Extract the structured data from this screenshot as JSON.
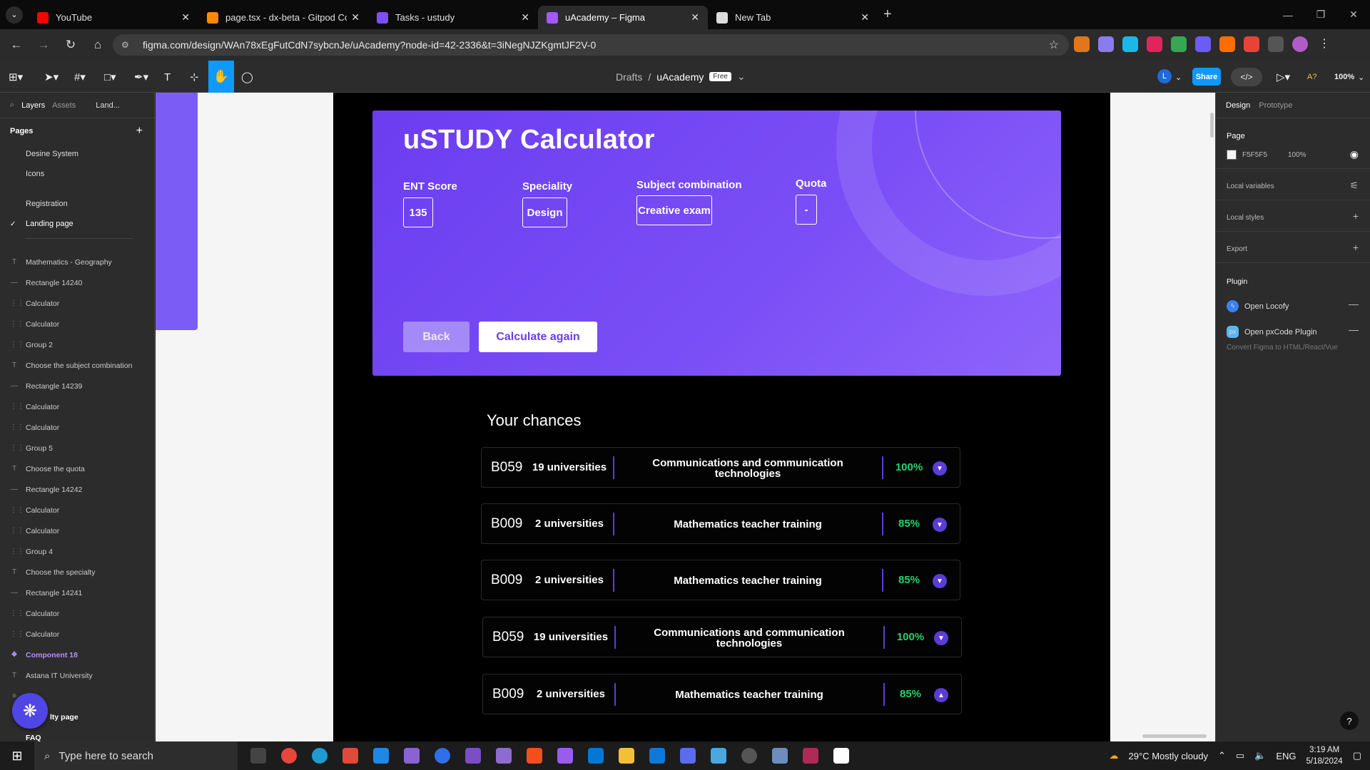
{
  "browser": {
    "tabs": [
      {
        "title": "YouTube",
        "color": "#ff0000",
        "active": false
      },
      {
        "title": "page.tsx - dx-beta - Gitpod Co",
        "color": "#ff8a00",
        "active": false
      },
      {
        "title": "Tasks - ustudy",
        "color": "#7b4ff6",
        "active": false
      },
      {
        "title": "uAcademy – Figma",
        "color": "#a259ff",
        "active": true
      },
      {
        "title": "New Tab",
        "color": "#dddddd",
        "active": false
      }
    ],
    "url": "figma.com/design/WAn78xEgFutCdN7sybcnJe/uAcademy?node-id=42-2336&t=3iNegNJZKgmtJF2V-0"
  },
  "figma": {
    "breadcrumb_root": "Drafts",
    "file_name": "uAcademy",
    "plan_badge": "Free",
    "user_initial": "L",
    "share_label": "Share",
    "zoom": "100%",
    "left_tabs": {
      "layers": "Layers",
      "assets": "Assets",
      "page_short": "Land..."
    },
    "pages_heading": "Pages",
    "pages": [
      "Desine System",
      "Icons",
      "Registration",
      "Landing page"
    ],
    "current_page": "Landing page",
    "layers": [
      {
        "name": "Mathematics - Geography",
        "kind": "text"
      },
      {
        "name": "Rectangle 14240",
        "kind": "line"
      },
      {
        "name": "Calculator",
        "kind": "frame"
      },
      {
        "name": "Calculator",
        "kind": "frame"
      },
      {
        "name": "Group 2",
        "kind": "frame"
      },
      {
        "name": "Choose the subject combination",
        "kind": "text"
      },
      {
        "name": "Rectangle 14239",
        "kind": "line"
      },
      {
        "name": "Calculator",
        "kind": "frame"
      },
      {
        "name": "Calculator",
        "kind": "frame"
      },
      {
        "name": "Group 5",
        "kind": "frame"
      },
      {
        "name": "Choose the quota",
        "kind": "text"
      },
      {
        "name": "Rectangle 14242",
        "kind": "line"
      },
      {
        "name": "Calculator",
        "kind": "frame"
      },
      {
        "name": "Calculator",
        "kind": "frame"
      },
      {
        "name": "Group 4",
        "kind": "frame"
      },
      {
        "name": "Choose the specialty",
        "kind": "text"
      },
      {
        "name": "Rectangle 14241",
        "kind": "line"
      },
      {
        "name": "Calculator",
        "kind": "frame"
      },
      {
        "name": "Calculator",
        "kind": "frame"
      },
      {
        "name": "Component 18",
        "kind": "component"
      },
      {
        "name": "Astana IT University",
        "kind": "text"
      },
      {
        "name": "",
        "kind": "list"
      },
      {
        "name": "lty page",
        "kind": "page"
      },
      {
        "name": "FAQ",
        "kind": "page"
      }
    ],
    "right_tabs": {
      "design": "Design",
      "prototype": "Prototype"
    },
    "page_section": "Page",
    "page_color": "F5F5F5",
    "page_opacity": "100%",
    "local_variables": "Local variables",
    "local_styles": "Local styles",
    "export": "Export",
    "plugin_heading": "Plugin",
    "plugins": [
      "Open Locofy",
      "Open pxCode Plugin"
    ],
    "plugin_hint": "Convert Figma to HTML/React/Vue"
  },
  "calculator": {
    "title": "uSTUDY Calculator",
    "fields": [
      {
        "label": "ENT Score",
        "value": "135"
      },
      {
        "label": "Speciality",
        "value": "Design"
      },
      {
        "label": "Subject combination",
        "value": "Creative exam"
      },
      {
        "label": "Quota",
        "value": "-"
      }
    ],
    "back_label": "Back",
    "again_label": "Calculate again"
  },
  "chances": {
    "heading": "Your chances",
    "rows": [
      {
        "code": "B059",
        "universities": "19 universities",
        "specialty": "Communications and communication technologies",
        "chance": "100%",
        "expanded": false
      },
      {
        "code": "B009",
        "universities": "2 universities",
        "specialty": "Mathematics teacher training",
        "chance": "85%",
        "expanded": false
      },
      {
        "code": "B009",
        "universities": "2 universities",
        "specialty": "Mathematics teacher training",
        "chance": "85%",
        "expanded": false
      },
      {
        "code": "B059",
        "universities": "19 universities",
        "specialty": "Communications and communication technologies",
        "chance": "100%",
        "expanded": false
      },
      {
        "code": "B009",
        "universities": "2 universities",
        "specialty": "Mathematics teacher training",
        "chance": "85%",
        "expanded": true
      }
    ]
  },
  "taskbar": {
    "search_placeholder": "Type here to search",
    "weather": "29°C  Mostly cloudy",
    "language": "ENG",
    "time": "3:19 AM",
    "date": "5/18/2024"
  }
}
